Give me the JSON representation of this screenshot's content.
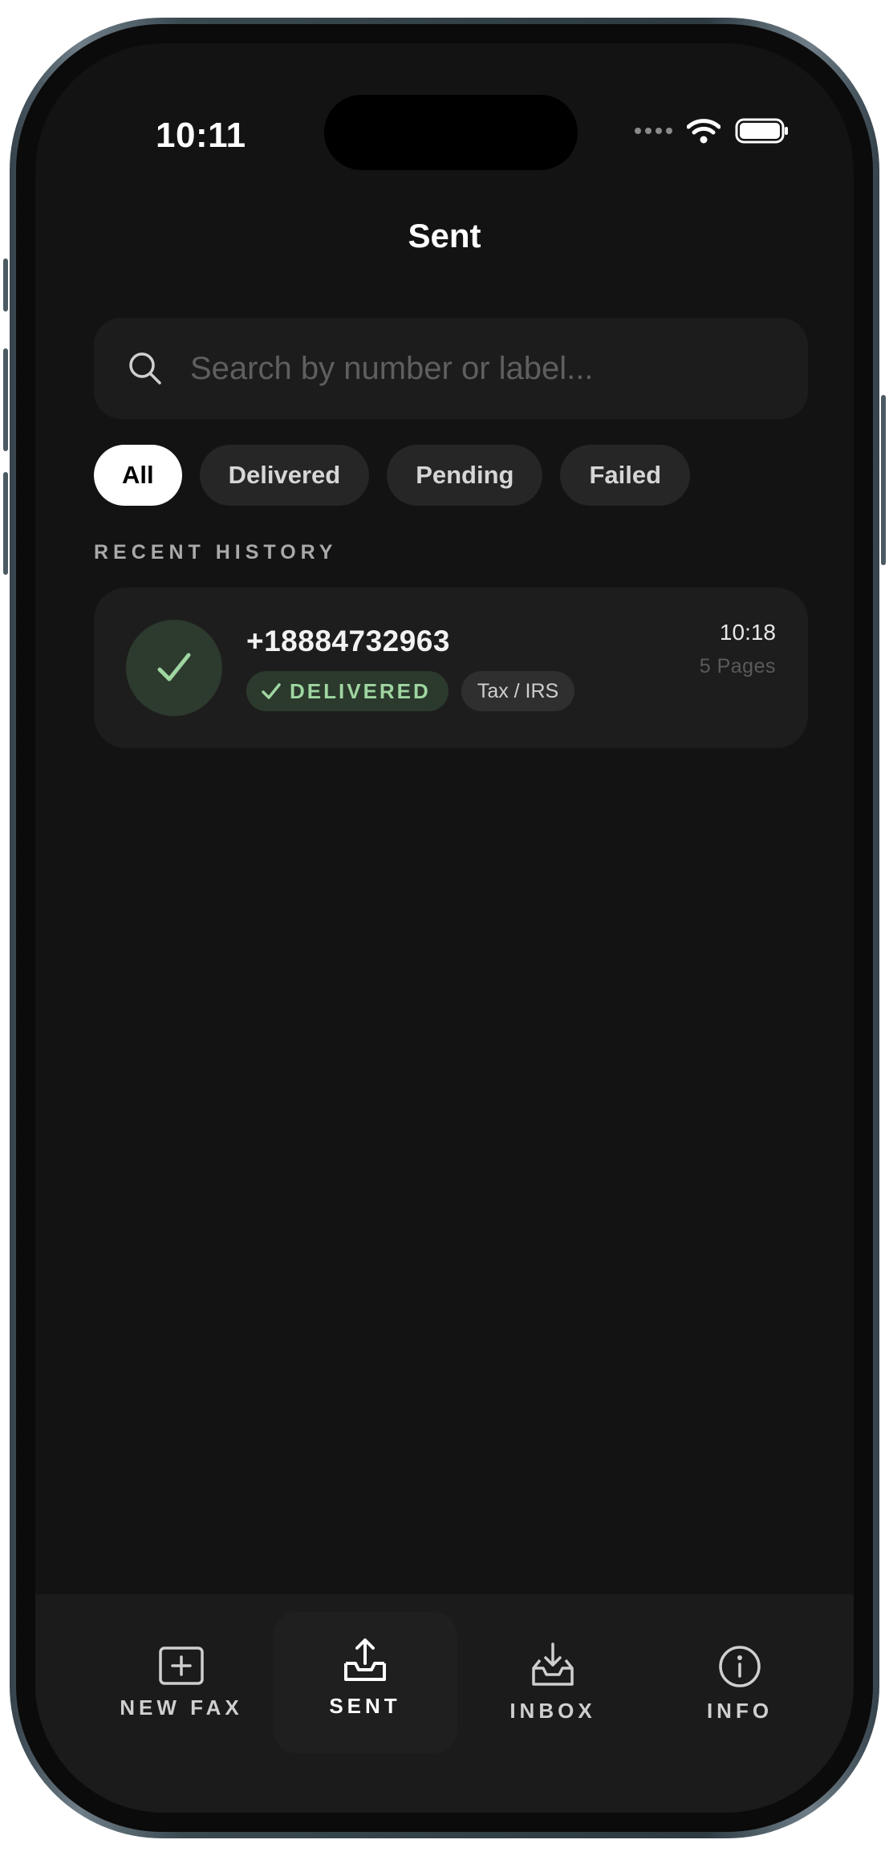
{
  "status_bar": {
    "time": "10:11"
  },
  "header": {
    "title": "Sent"
  },
  "search": {
    "placeholder": "Search by number or label..."
  },
  "filters": [
    {
      "label": "All",
      "active": true
    },
    {
      "label": "Delivered",
      "active": false
    },
    {
      "label": "Pending",
      "active": false
    },
    {
      "label": "Failed",
      "active": false
    }
  ],
  "section": {
    "label": "RECENT HISTORY"
  },
  "history": [
    {
      "number": "+18884732963",
      "status": "DELIVERED",
      "label": "Tax / IRS",
      "time": "10:18",
      "pages": "5 Pages"
    }
  ],
  "tabbar": {
    "items": [
      {
        "label": "NEW FAX",
        "icon": "new-fax-icon"
      },
      {
        "label": "SENT",
        "icon": "sent-icon",
        "active": true
      },
      {
        "label": "INBOX",
        "icon": "inbox-icon"
      },
      {
        "label": "INFO",
        "icon": "info-icon"
      }
    ]
  },
  "colors": {
    "background": "#131313",
    "card": "#1d1d1d",
    "success_text": "#9fd6a1",
    "success_bg": "#2b3a2d"
  }
}
